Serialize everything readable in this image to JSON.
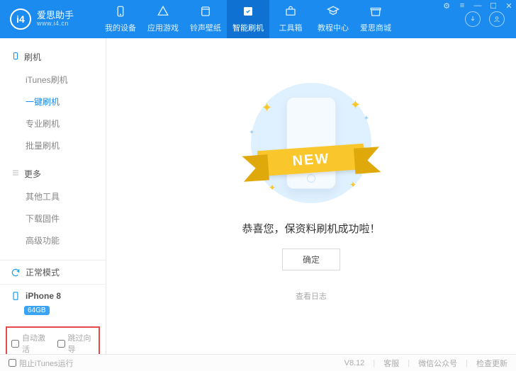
{
  "brand": {
    "title": "爱思助手",
    "subtitle": "www.i4.cn",
    "logo_text": "i4"
  },
  "window_controls": {
    "settings": "⚙",
    "menu": "≡",
    "minimize": "—",
    "maximize": "☐",
    "close": "✕"
  },
  "nav": {
    "device": "我的设备",
    "apps": "应用游戏",
    "ringtones": "铃声壁纸",
    "flash": "智能刷机",
    "toolbox": "工具箱",
    "tutorials": "教程中心",
    "store": "爱思商城"
  },
  "header_icons": {
    "download": "↓",
    "user": "👤"
  },
  "sidebar": {
    "section_flash": "刷机",
    "itunes_flash": "iTunes刷机",
    "one_key_flash": "一键刷机",
    "pro_flash": "专业刷机",
    "batch_flash": "批量刷机",
    "section_more": "更多",
    "other_tools": "其他工具",
    "download_fw": "下载固件",
    "advanced": "高级功能",
    "mode": "正常模式",
    "device": "iPhone 8",
    "storage": "64GB",
    "auto_activate": "自动激活",
    "skip_wizard": "跳过向导"
  },
  "main": {
    "ribbon": "NEW",
    "success": "恭喜您，保资料刷机成功啦！",
    "ok": "确定",
    "view_log": "查看日志"
  },
  "footer": {
    "block_itunes": "阻止iTunes运行",
    "version": "V8.12",
    "support": "客服",
    "wechat": "微信公众号",
    "check_update": "检查更新"
  }
}
